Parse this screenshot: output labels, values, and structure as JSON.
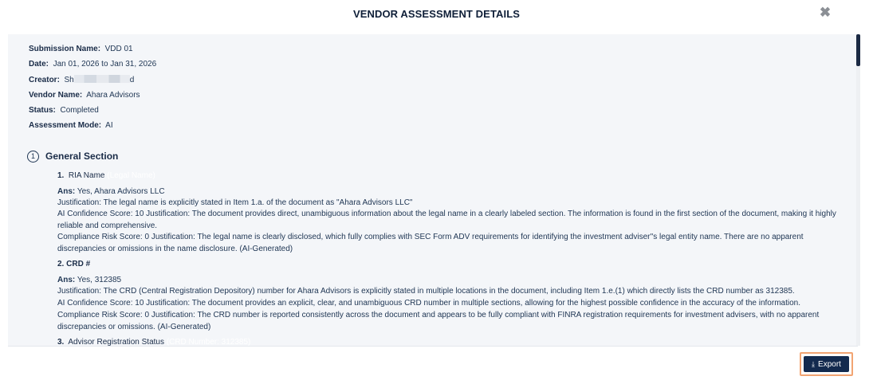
{
  "modal": {
    "title": "VENDOR ASSESSMENT DETAILS",
    "close_icon": "close-icon",
    "export_label": "Export",
    "export_icon": "download-icon"
  },
  "meta": {
    "submission_label": "Submission Name:",
    "submission_value": "VDD 01",
    "date_label": "Date:",
    "date_value": "Jan 01, 2026 to Jan 31, 2026",
    "creator_label": "Creator:",
    "creator_prefix": "Sh",
    "creator_suffix": "d",
    "vendor_label": "Vendor Name:",
    "vendor_value": "Ahara Advisors",
    "status_label": "Status:",
    "status_value": "Completed",
    "mode_label": "Assessment Mode:",
    "mode_value": "AI"
  },
  "section": {
    "number": "1",
    "title": "General Section"
  },
  "questions": [
    {
      "num": "1.",
      "label": "RIA Name",
      "hint": "(Legal Name)",
      "ans_label": "Ans:",
      "ans_value": "Yes, Ahara Advisors LLC",
      "lines": [
        "Justification: The legal name is explicitly stated in Item 1.a. of the document as \"Ahara Advisors LLC\"",
        "AI Confidence Score: 10 Justification: The document provides direct, unambiguous information about the legal name in a clearly labeled section. The information is found in the first section of the document, making it highly reliable and comprehensive.",
        "Compliance Risk Score: 0 Justification: The legal name is clearly disclosed, which fully complies with SEC Form ADV requirements for identifying the investment adviser''s legal entity name. There are no apparent discrepancies or omissions in the name disclosure. (AI-Generated)"
      ]
    },
    {
      "num": "2.",
      "label": "CRD #",
      "ans_label": "Ans:",
      "ans_value": "Yes, 312385",
      "lines": [
        "Justification: The CRD (Central Registration Depository) number for Ahara Advisors is explicitly stated in multiple locations in the document, including Item 1.e.(1) which directly lists the CRD number as 312385.",
        "AI Confidence Score: 10 Justification: The document provides an explicit, clear, and unambiguous CRD number in multiple sections, allowing for the highest possible confidence in the accuracy of the information.",
        "Compliance Risk Score: 0 Justification: The CRD number is reported consistently across the document and appears to be fully compliant with FINRA registration requirements for investment advisers, with no apparent discrepancies or omissions. (AI-Generated)"
      ]
    },
    {
      "num": "3.",
      "label": "Advisor Registration Status",
      "hint": "(CRD Number: 312385)"
    }
  ]
}
